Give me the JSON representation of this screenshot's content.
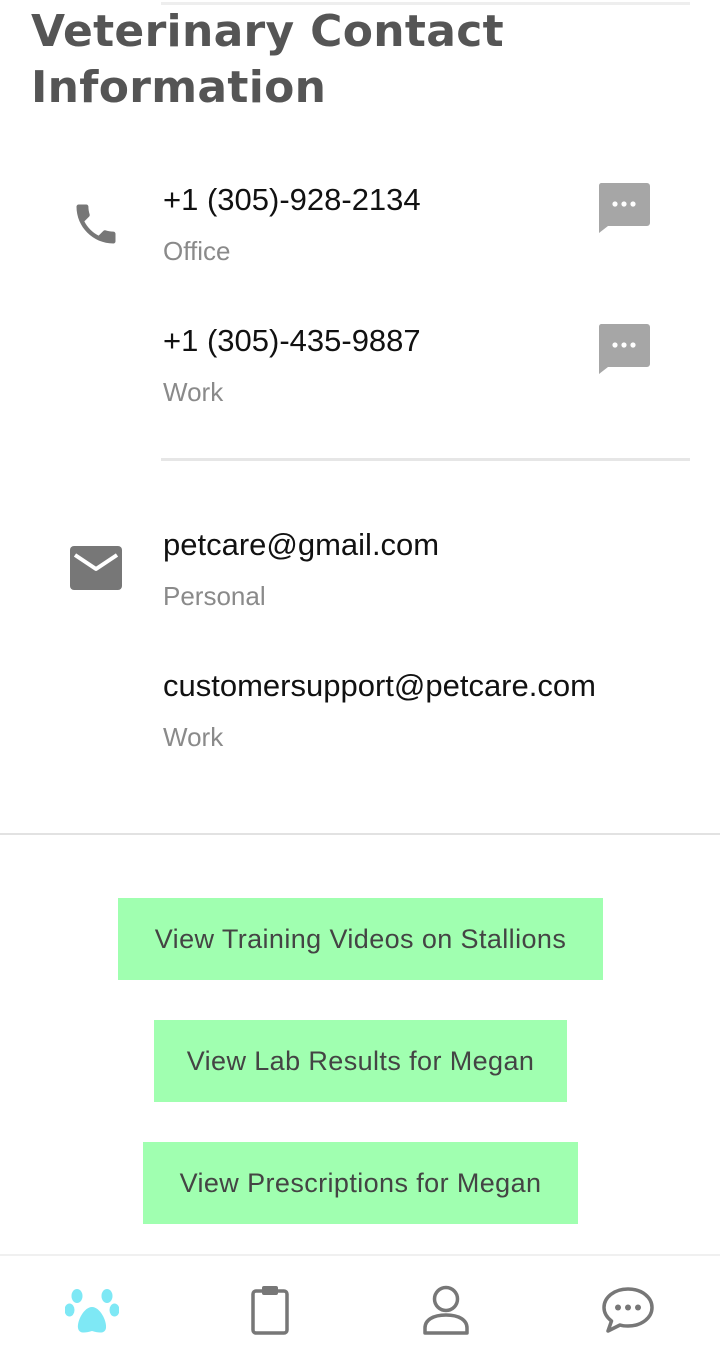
{
  "page": {
    "title": "Veterinary Contact\nInformation"
  },
  "phones": [
    {
      "number": "+1 (305)-928-2134",
      "label": "Office"
    },
    {
      "number": "+1 (305)-435-9887",
      "label": "Work"
    }
  ],
  "emails": [
    {
      "address": "petcare@gmail.com",
      "label": "Personal"
    },
    {
      "address": "customersupport@petcare.com",
      "label": "Work"
    }
  ],
  "buttons": {
    "training": "View Training Videos on Stallions",
    "lab_results": "View Lab Results for Megan",
    "prescriptions": "View Prescriptions for Megan"
  },
  "tabs": [
    {
      "icon": "paw-icon",
      "active": true
    },
    {
      "icon": "clipboard-icon",
      "active": false
    },
    {
      "icon": "person-icon",
      "active": false
    },
    {
      "icon": "chat-bubble-icon",
      "active": false
    }
  ],
  "colors": {
    "button_bg": "#a0ffb0",
    "active_tab": "#7ee8f5",
    "inactive_icon": "#777777",
    "title": "#555555"
  }
}
